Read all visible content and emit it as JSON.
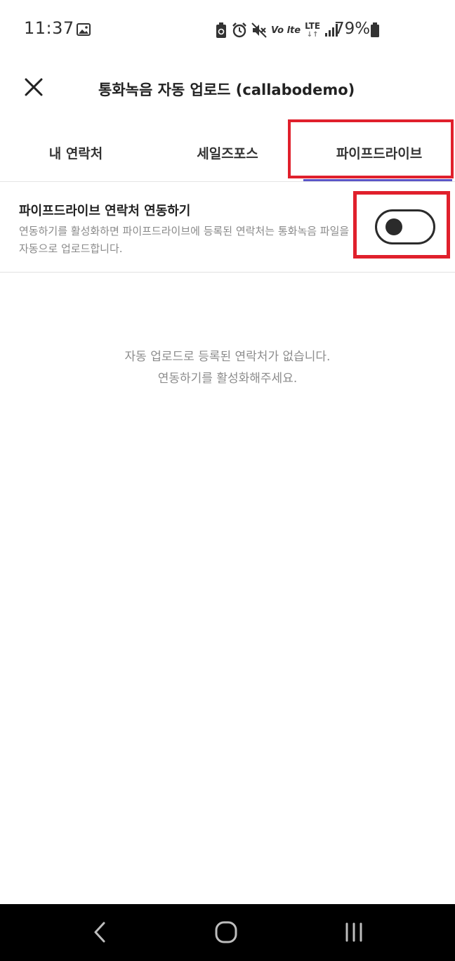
{
  "status_bar": {
    "time": "11:37",
    "volte_label": "Vo lte",
    "lte_label": "LTE",
    "battery": "79%"
  },
  "header": {
    "title": "통화녹음 자동 업로드 (callabodemo)"
  },
  "tabs": [
    {
      "label": "내 연락처",
      "selected": false
    },
    {
      "label": "세일즈포스",
      "selected": false
    },
    {
      "label": "파이프드라이브",
      "selected": true
    }
  ],
  "setting": {
    "title": "파이프드라이브 연락처 연동하기",
    "description": "연동하기를 활성화하면 파이프드라이브에 등록된 연락처는 통화녹음 파일을 자동으로 업로드합니다.",
    "toggle_on": false
  },
  "empty_state": {
    "line1": "자동 업로드로 등록된 연락처가 없습니다.",
    "line2": "연동하기를 활성화해주세요."
  },
  "colors": {
    "accent": "#5a55c8",
    "highlight": "#e0202c",
    "navbar": "#000000"
  },
  "icons": {
    "close": "close-icon",
    "back": "back-icon",
    "home": "home-icon",
    "recents": "recents-icon"
  }
}
